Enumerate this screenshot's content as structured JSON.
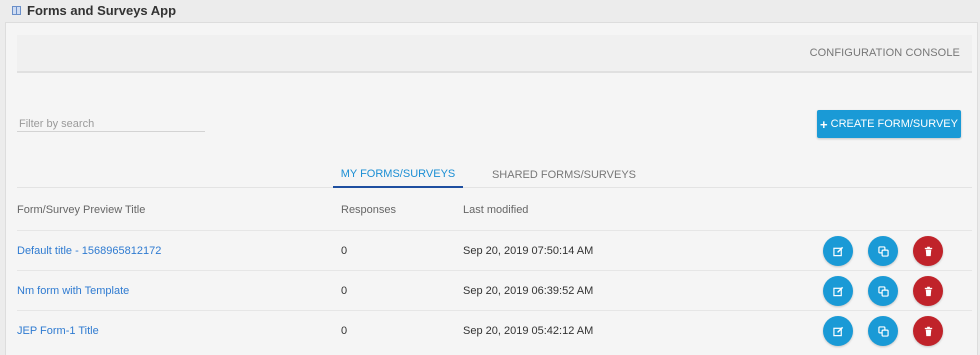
{
  "app": {
    "title": "Forms and Surveys App"
  },
  "console": {
    "label": "CONFIGURATION CONSOLE"
  },
  "search": {
    "placeholder": "Filter by search",
    "value": ""
  },
  "create_button": {
    "label": "CREATE FORM/SURVEY"
  },
  "tabs": [
    {
      "label": "MY FORMS/SURVEYS",
      "active": true
    },
    {
      "label": "SHARED FORMS/SURVEYS",
      "active": false
    }
  ],
  "table": {
    "headers": [
      "Form/Survey Preview Title",
      "Responses",
      "Last modified"
    ],
    "rows": [
      {
        "title": "Default title - 1568965812172",
        "responses": "0",
        "modified": "Sep 20, 2019 07:50:14 AM"
      },
      {
        "title": "Nm form with Template",
        "responses": "0",
        "modified": "Sep 20, 2019 06:39:52 AM"
      },
      {
        "title": "JEP Form-1 Title",
        "responses": "0",
        "modified": "Sep 20, 2019 05:42:12 AM"
      }
    ]
  },
  "actions": {
    "edit_icon": "edit-icon",
    "copy_icon": "copy-icon",
    "delete_icon": "trash-icon"
  },
  "colors": {
    "primary": "#1a9ad6",
    "danger": "#c0232a",
    "link": "#2f7bd1",
    "tab_underline": "#1e4fa0"
  }
}
